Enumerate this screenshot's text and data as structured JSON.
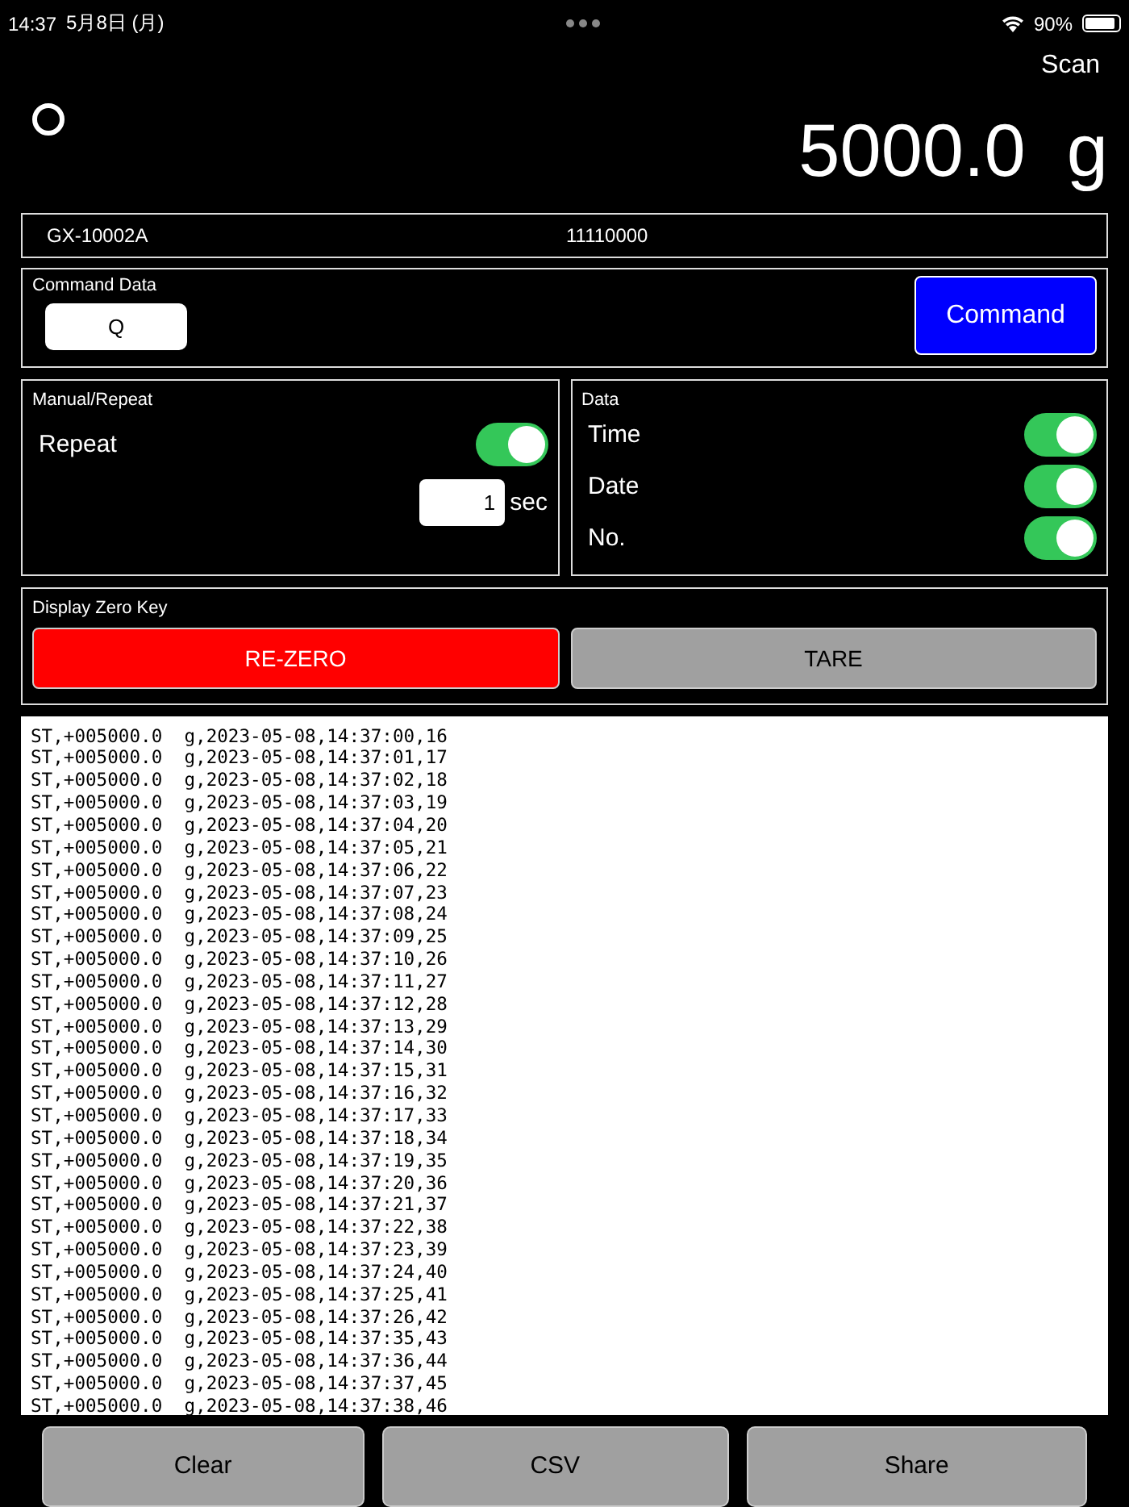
{
  "status_bar": {
    "time": "14:37",
    "date": "5月8日 (月)",
    "battery": "90%"
  },
  "scan": "Scan",
  "weight": "5000.0  g",
  "device": {
    "model": "GX-10002A",
    "serial": "11110000"
  },
  "command_data": {
    "title": "Command Data",
    "value": "Q",
    "button": "Command"
  },
  "manual_repeat": {
    "title": "Manual/Repeat",
    "label": "Repeat",
    "on": true,
    "interval": "1",
    "unit": "sec"
  },
  "data": {
    "title": "Data",
    "toggles": [
      {
        "label": "Time",
        "on": true
      },
      {
        "label": "Date",
        "on": true
      },
      {
        "label": "No.",
        "on": true
      }
    ]
  },
  "zero_key": {
    "title": "Display Zero Key",
    "buttons": [
      {
        "label": "RE-ZERO",
        "kind": "primary"
      },
      {
        "label": "TARE",
        "kind": "secondary"
      }
    ]
  },
  "log": [
    "ST,+005000.0  g,2023-05-08,14:37:00,16",
    "ST,+005000.0  g,2023-05-08,14:37:01,17",
    "ST,+005000.0  g,2023-05-08,14:37:02,18",
    "ST,+005000.0  g,2023-05-08,14:37:03,19",
    "ST,+005000.0  g,2023-05-08,14:37:04,20",
    "ST,+005000.0  g,2023-05-08,14:37:05,21",
    "ST,+005000.0  g,2023-05-08,14:37:06,22",
    "ST,+005000.0  g,2023-05-08,14:37:07,23",
    "ST,+005000.0  g,2023-05-08,14:37:08,24",
    "ST,+005000.0  g,2023-05-08,14:37:09,25",
    "ST,+005000.0  g,2023-05-08,14:37:10,26",
    "ST,+005000.0  g,2023-05-08,14:37:11,27",
    "ST,+005000.0  g,2023-05-08,14:37:12,28",
    "ST,+005000.0  g,2023-05-08,14:37:13,29",
    "ST,+005000.0  g,2023-05-08,14:37:14,30",
    "ST,+005000.0  g,2023-05-08,14:37:15,31",
    "ST,+005000.0  g,2023-05-08,14:37:16,32",
    "ST,+005000.0  g,2023-05-08,14:37:17,33",
    "ST,+005000.0  g,2023-05-08,14:37:18,34",
    "ST,+005000.0  g,2023-05-08,14:37:19,35",
    "ST,+005000.0  g,2023-05-08,14:37:20,36",
    "ST,+005000.0  g,2023-05-08,14:37:21,37",
    "ST,+005000.0  g,2023-05-08,14:37:22,38",
    "ST,+005000.0  g,2023-05-08,14:37:23,39",
    "ST,+005000.0  g,2023-05-08,14:37:24,40",
    "ST,+005000.0  g,2023-05-08,14:37:25,41",
    "ST,+005000.0  g,2023-05-08,14:37:26,42",
    "ST,+005000.0  g,2023-05-08,14:37:35,43",
    "ST,+005000.0  g,2023-05-08,14:37:36,44",
    "ST,+005000.0  g,2023-05-08,14:37:37,45",
    "ST,+005000.0  g,2023-05-08,14:37:38,46"
  ],
  "bottom_buttons": [
    "Clear",
    "CSV",
    "Share"
  ]
}
